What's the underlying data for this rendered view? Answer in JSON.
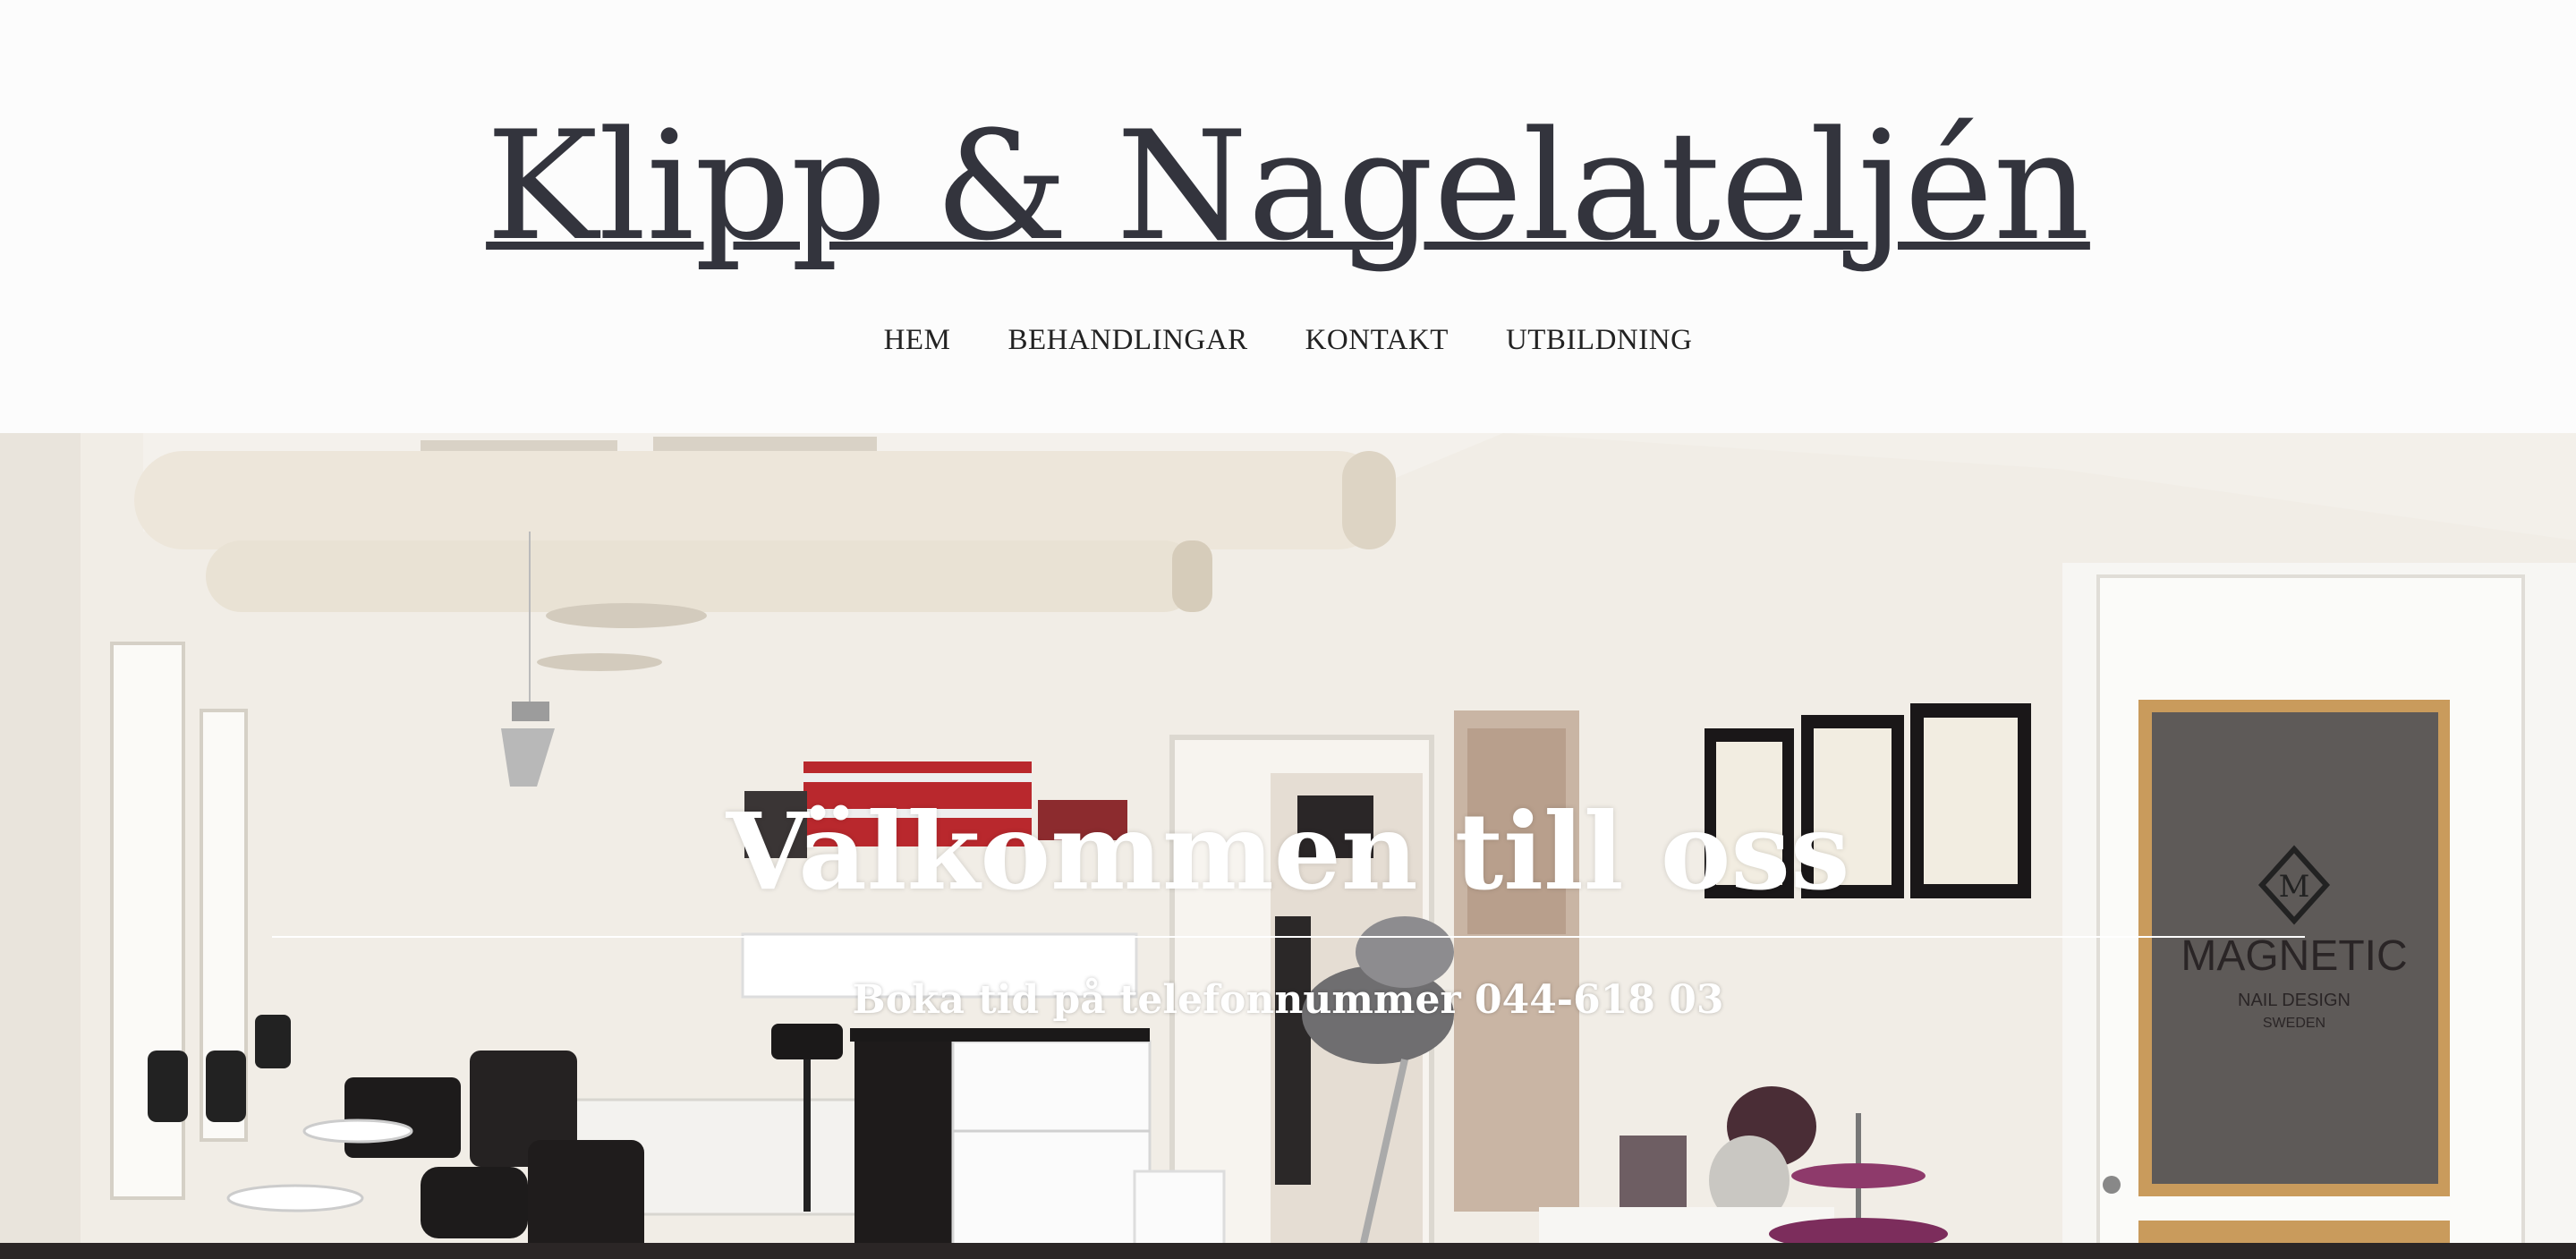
{
  "site": {
    "title": "Klipp & Nagelateljén"
  },
  "nav": {
    "items": [
      {
        "label": "HEM"
      },
      {
        "label": "BEHANDLINGAR"
      },
      {
        "label": "KONTAKT"
      },
      {
        "label": "UTBILDNING"
      }
    ]
  },
  "hero": {
    "heading": "Välkommen till oss",
    "subheading": "Boka tid på telefonnummer 044-618 03",
    "door_sign": {
      "brand": "MAGNETIC",
      "line1": "NAIL DESIGN",
      "line2": "SWEDEN"
    }
  },
  "colors": {
    "title": "#33343d",
    "background": "#fcfcfc",
    "hero_text": "#ffffff"
  }
}
